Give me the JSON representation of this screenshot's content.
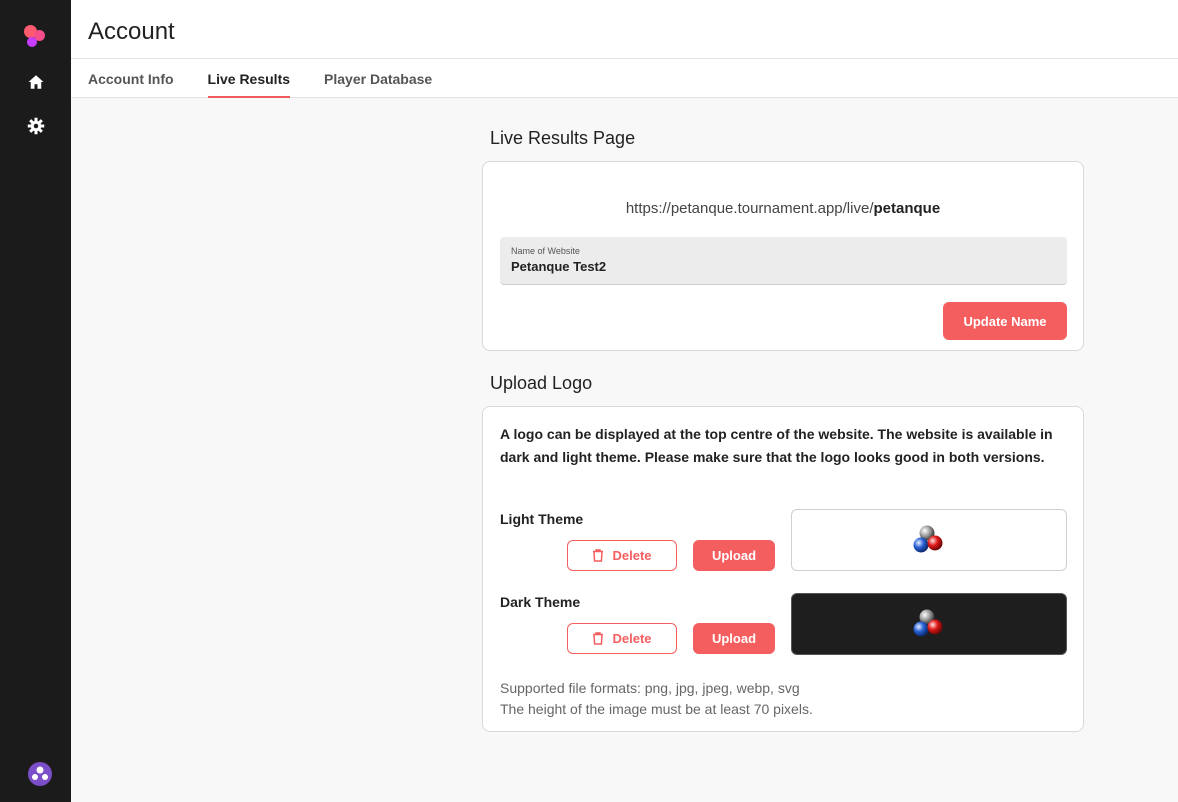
{
  "sidebar": {
    "items": [
      {
        "name": "home-icon"
      },
      {
        "name": "gear-icon"
      }
    ],
    "brand_colors": [
      "#ff5a6e",
      "#f54e8a",
      "#c73cff"
    ]
  },
  "header": {
    "title": "Account"
  },
  "tabs": [
    {
      "label": "Account Info",
      "active": false
    },
    {
      "label": "Live Results",
      "active": true
    },
    {
      "label": "Player Database",
      "active": false
    }
  ],
  "live_results": {
    "section_title": "Live Results Page",
    "url_prefix": "https://petanque.tournament.app/live/",
    "url_slug": "petanque",
    "name_field": {
      "label": "Name of Website",
      "value": "Petanque Test2"
    },
    "update_button": "Update Name"
  },
  "upload_logo": {
    "section_title": "Upload Logo",
    "description": "A logo can be displayed at the top centre of the website. The website is available in dark and light theme. Please make sure that the logo looks good in both versions.",
    "light": {
      "label": "Light Theme",
      "delete_label": "Delete",
      "upload_label": "Upload"
    },
    "dark": {
      "label": "Dark Theme",
      "delete_label": "Delete",
      "upload_label": "Upload"
    },
    "formats_line1": "Supported file formats: png, jpg, jpeg, webp, svg",
    "formats_line2": "The height of the image must be at least 70 pixels."
  },
  "colors": {
    "accent": "#f55e5f",
    "sidebar_bg": "#1b1b1b"
  }
}
